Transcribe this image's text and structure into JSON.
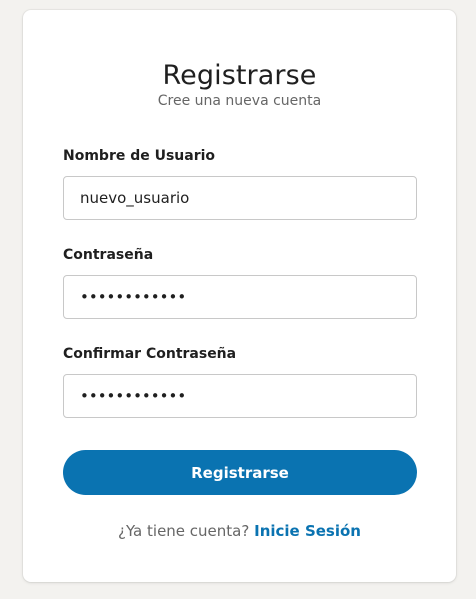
{
  "form": {
    "title": "Registrarse",
    "subtitle": "Cree una nueva cuenta",
    "username": {
      "label": "Nombre de Usuario",
      "value": "nuevo_usuario"
    },
    "password": {
      "label": "Contraseña",
      "value": "passwordabcd"
    },
    "confirm_password": {
      "label": "Confirmar Contraseña",
      "value": "passwordabcd"
    },
    "submit_label": "Registrarse",
    "footer_prompt": "¿Ya tiene cuenta?",
    "login_link": "Inicie Sesión"
  },
  "colors": {
    "accent": "#0a73b1",
    "background": "#f3f2ef",
    "card": "#ffffff"
  }
}
